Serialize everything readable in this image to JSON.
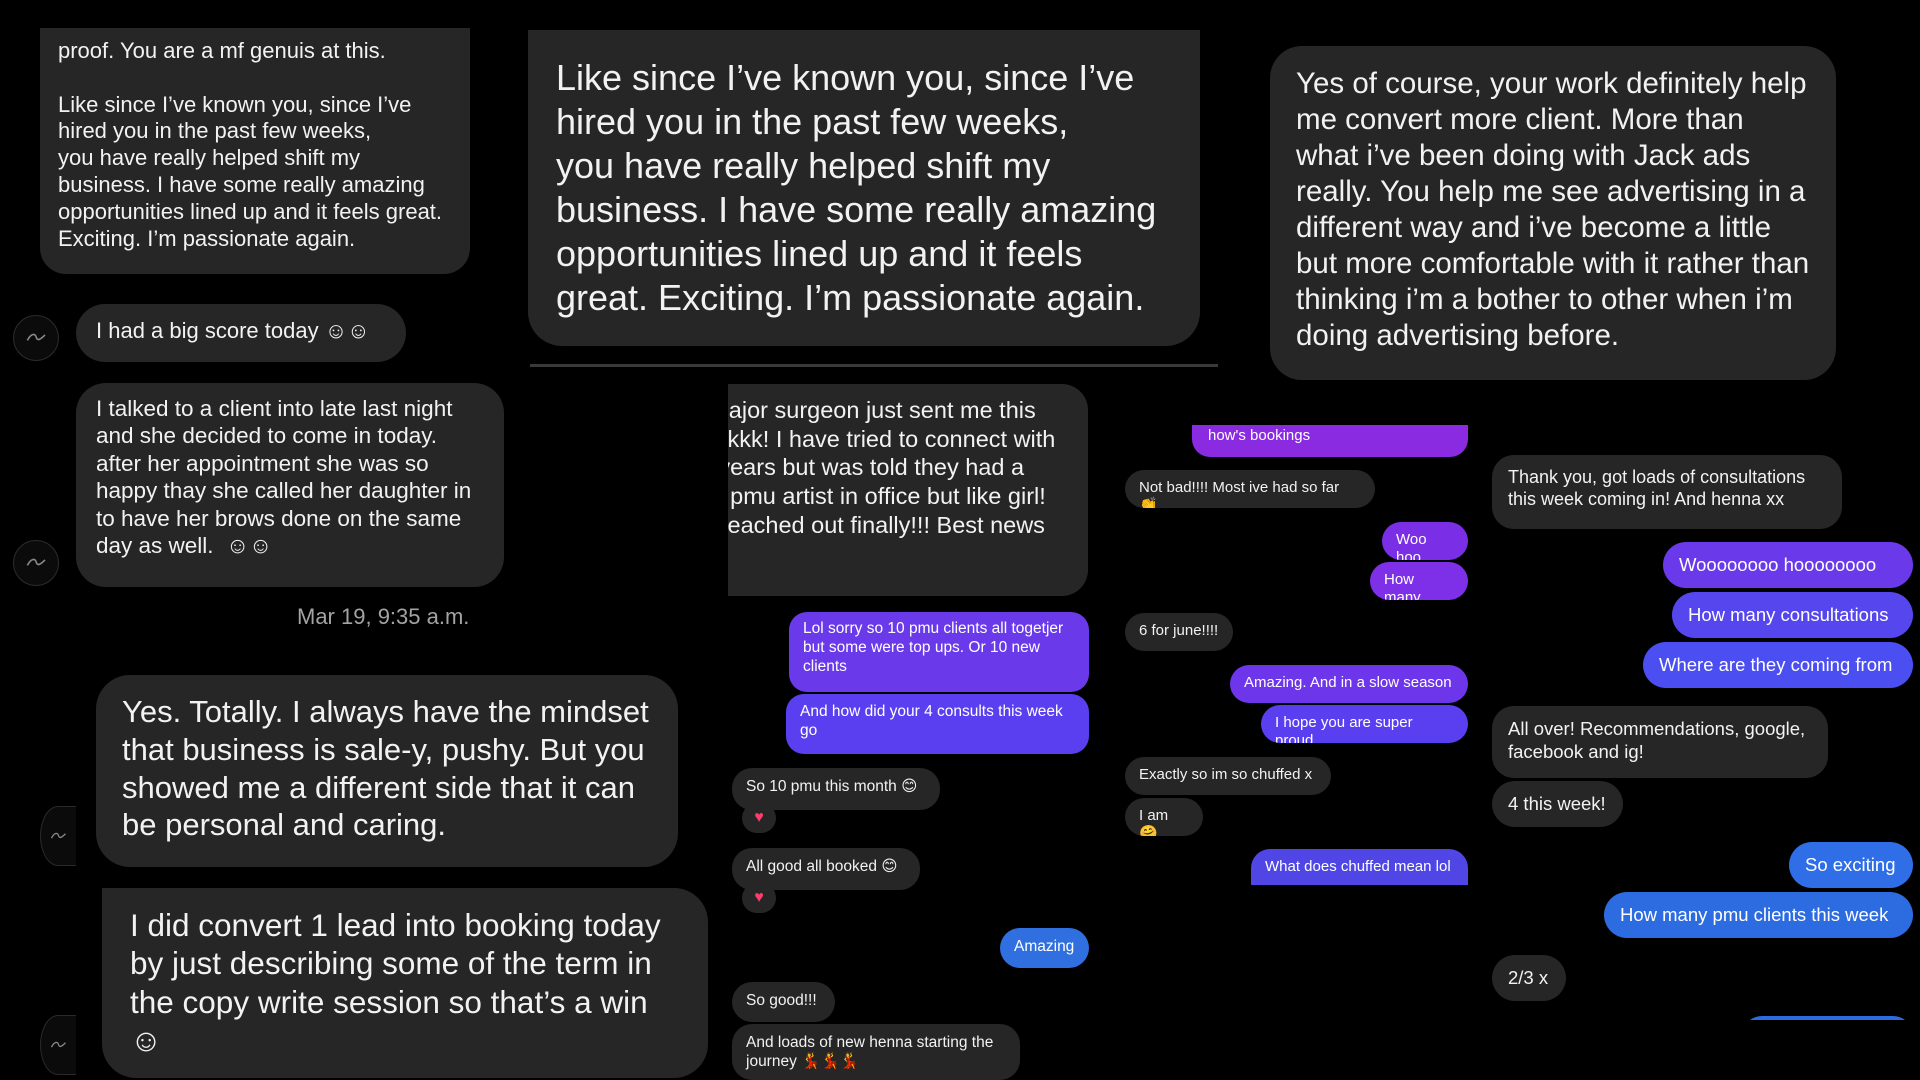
{
  "panel1": {
    "msg_top": "proof. You are a mf genuis at this.\n\nLike since I’ve known you, since I’ve hired you in the past few weeks,\nyou have really helped shift my business. I have some really amazing opportunities lined up and it feels great. Exciting. I’m passionate again.",
    "msg_score": "I had a big score today ☺☺",
    "msg_client": "I talked to a client into late last night and she decided to come in today. after her appointment she was so happy thay she called her daughter in to have her brows done on the same day as well.  ☺☺",
    "timestamp": "Mar 19, 9:35 a.m."
  },
  "panel2": {
    "msg_large": "Like since I’ve known you, since I’ve hired you in the past few weeks,\nyou have really helped shift my business. I have some really amazing opportunities lined up and it feels great. Exciting. I’m passionate again."
  },
  "panel3": {
    "msg_large": "Yes of course, your work definitely help me convert more client. More than what i’ve been doing with Jack ads really. You help me see advertising in a different way and i’ve become a little but more comfortable with it rather than thinking i’m a bother to other when i’m doing advertising before."
  },
  "panel4": {
    "msg_yes": "Yes. Totally. I always have the mindset that business is sale-y, pushy. But you showed me a different side that it can be personal and caring.",
    "msg_convert": "I did convert 1 lead into booking today by just describing some of the term in the copy write session so that’s a win ☺"
  },
  "panel5": {
    "msg_surgeon": "Girl. A major surgeon just sent me this too. Okkkkk! I have tried to connect with him for years but was told they had a resident pmu artist in office but like girl! He just reached out finally!!! Best news ever!",
    "msg_lol": "Lol sorry so 10 pmu clients all togetjer but some were top ups. Or 10 new clients",
    "msg_consults": "And how did your 4 consults this week go",
    "msg_10pmu": "So 10 pmu this month 😊",
    "msg_allgood": "All good all booked 😊",
    "msg_amazing": "Amazing",
    "msg_sogood": "So good!!!",
    "msg_henna": "And loads of new henna starting the journey 💃💃💃",
    "reaction": "♥"
  },
  "panel6": {
    "msg_bookings": "how's bookings",
    "msg_notbad": "Not bad!!!! Most ive had so far 👏",
    "msg_woohoo": "Woo hoo",
    "msg_howmany": "How many",
    "msg_june": "6 for june!!!!",
    "msg_slow": "Amazing. And in a slow season",
    "msg_proud": "I hope you are super proud",
    "msg_chuffed": "Exactly so im so chuffed x",
    "msg_iam": "I am 🤗",
    "msg_what": "What does chuffed mean lol"
  },
  "panel7": {
    "msg_thanks": "Thank you, got loads of consultations this week coming in! And henna xx",
    "msg_woo": "Woooooooo hoooooooo",
    "msg_howmanyc": "How many consultations",
    "msg_where": "Where are they coming from",
    "msg_allover": "All over! Recommendations, google, facebook and ig!",
    "msg_4week": "4 this week!",
    "msg_exciting": "So exciting",
    "msg_pmu": "How many pmu clients this week",
    "msg_23": "2/3 x"
  },
  "colors": {
    "background": "#000000",
    "bubble_received": "#262626",
    "bubble_sent_purple": "#7a2ee6",
    "bubble_sent_violet": "#5a3ff0",
    "bubble_sent_blue": "#2f6fe0"
  }
}
